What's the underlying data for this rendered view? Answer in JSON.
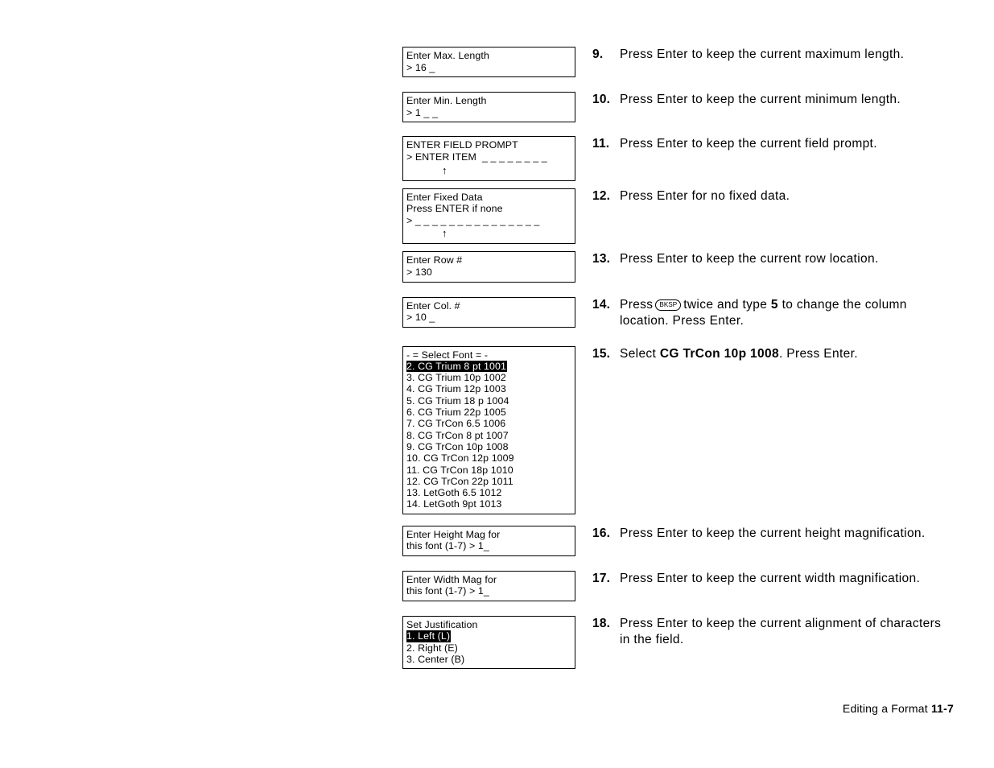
{
  "page": {
    "footer_label": "Editing a Format",
    "footer_page": "11-7"
  },
  "displays": {
    "max_length": {
      "line1": "Enter Max. Length",
      "line2": "> 16 _"
    },
    "min_length": {
      "line1": "Enter Min. Length",
      "line2": "> 1 _ _"
    },
    "field_prompt": {
      "line1": "ENTER FIELD PROMPT",
      "line2": "> ENTER ITEM  _ _ _ _ _ _ _ _",
      "cursor": "↑"
    },
    "fixed_data": {
      "line1": "Enter Fixed Data",
      "line2": "Press ENTER if none",
      "line3": "> _ _ _ _ _ _ _ _ _ _ _ _ _ _ _",
      "cursor": "↑"
    },
    "row_number": {
      "line1": "Enter Row #",
      "line2": "> 130"
    },
    "col_number": {
      "line1": "Enter Col. #",
      "line2": "> 10 _"
    },
    "select_font": {
      "header": "- = Select Font = -",
      "selected_index": 0,
      "items": [
        "2. CG Trium 8 pt 1001",
        "3. CG Trium 10p 1002",
        "4. CG Trium 12p 1003",
        "5. CG Trium 18 p 1004",
        "6. CG Trium 22p 1005",
        "7. CG TrCon 6.5 1006",
        "8. CG TrCon 8 pt 1007",
        "9. CG TrCon 10p 1008",
        "10. CG TrCon 12p 1009",
        "11. CG TrCon 18p 1010",
        "12. CG TrCon 22p 1011",
        "13. LetGoth 6.5 1012",
        "14. LetGoth 9pt 1013"
      ]
    },
    "height_mag": {
      "line1": "Enter Height Mag for",
      "line2": "this font (1-7) > 1_"
    },
    "width_mag": {
      "line1": "Enter Width Mag for",
      "line2": "this font (1-7) > 1_"
    },
    "justification": {
      "header": "Set Justification",
      "selected_index": 0,
      "items": [
        "1. Left (L)",
        "2. Right (E)",
        "3. Center (B)"
      ]
    }
  },
  "steps": {
    "s9": {
      "num": "9.",
      "text": "Press Enter to keep the current maximum length."
    },
    "s10": {
      "num": "10.",
      "text": "Press Enter to keep the current minimum length."
    },
    "s11": {
      "num": "11.",
      "text": "Press Enter to keep the current field prompt."
    },
    "s12": {
      "num": "12.",
      "text": "Press Enter for no fixed data."
    },
    "s13": {
      "num": "13.",
      "text": "Press Enter to keep the current row location."
    },
    "s14": {
      "num": "14.",
      "part1": "Press",
      "key": "BKSP",
      "part2": "twice and type",
      "bold": "5",
      "part3": "to change the column location.  Press Enter."
    },
    "s15": {
      "num": "15.",
      "part1": "Select",
      "bold": "CG TrCon 10p 1008",
      "part2": ".  Press Enter."
    },
    "s16": {
      "num": "16.",
      "text": "Press Enter to keep the current height magnification."
    },
    "s17": {
      "num": "17.",
      "text": "Press Enter to keep the current width magnification."
    },
    "s18": {
      "num": "18.",
      "text": "Press Enter to keep the current alignment of characters in the field."
    }
  }
}
